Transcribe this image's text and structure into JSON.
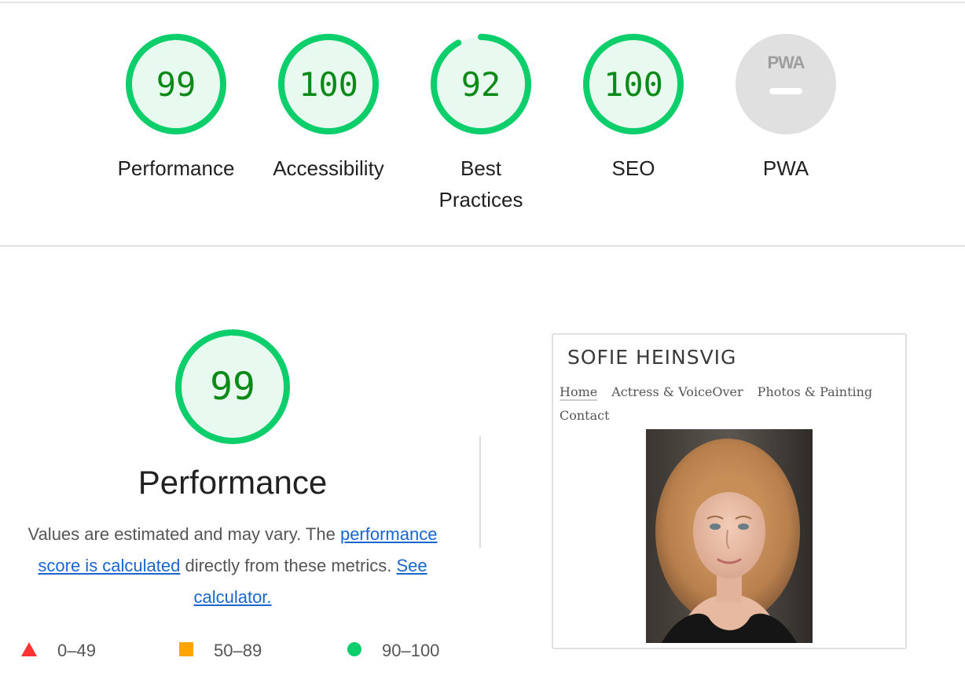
{
  "colors": {
    "pass": "#0cce6b",
    "pass_fill": "#e8f9ef",
    "pass_text": "#0b8a18",
    "fail": "#ff3333",
    "average": "#ffa400",
    "neutral": "#e0e0e0"
  },
  "summary": [
    {
      "score": 99,
      "label": "Performance",
      "fraction": 0.99
    },
    {
      "score": 100,
      "label": "Accessibility",
      "fraction": 1.0
    },
    {
      "score": 92,
      "label": "Best Practices",
      "fraction": 0.92
    },
    {
      "score": 100,
      "label": "SEO",
      "fraction": 1.0
    }
  ],
  "pwa": {
    "badge": "PWA",
    "label": "PWA"
  },
  "performance": {
    "score": 99,
    "fraction": 0.99,
    "title": "Performance",
    "desc_before": "Values are estimated and may vary. The ",
    "link1": "performance score is calculated",
    "desc_middle": " directly from these metrics. ",
    "link2": "See calculator."
  },
  "legend": [
    {
      "icon": "triangle-fail-icon",
      "range": "0–49"
    },
    {
      "icon": "square-average-icon",
      "range": "50–89"
    },
    {
      "icon": "circle-pass-icon",
      "range": "90–100"
    }
  ],
  "screenshot": {
    "site_title": "SOFIE HEINSVIG",
    "nav": [
      "Home",
      "Actress & VoiceOver",
      "Photos & Painting",
      "Contact"
    ]
  }
}
